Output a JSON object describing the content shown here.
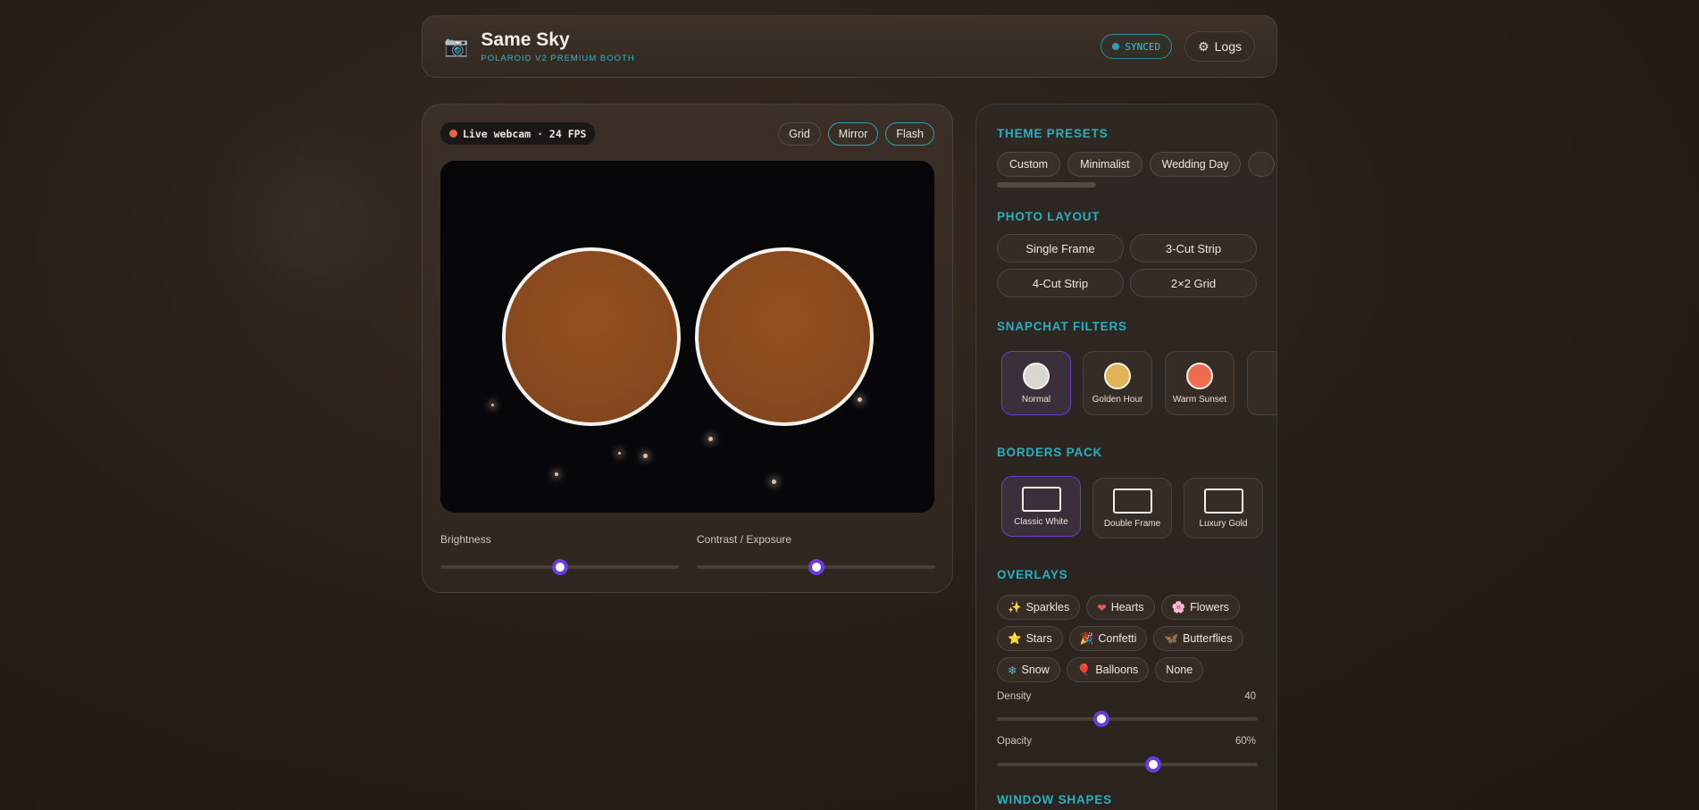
{
  "header": {
    "title": "Same Sky",
    "subtitle": "POLAROID V2 PREMIUM BOOTH",
    "synced_label": "SYNCED",
    "logs_label": "Logs",
    "camera_icon": "📷",
    "gear_icon": "⚙"
  },
  "stage": {
    "live_label": "Live webcam · 24 FPS",
    "toggles": [
      {
        "label": "Grid",
        "active": false
      },
      {
        "label": "Mirror",
        "active": true
      },
      {
        "label": "Flash",
        "active": true
      }
    ],
    "brightness_label": "Brightness",
    "brightness_value": 0.5,
    "contrast_label": "Contrast / Exposure",
    "contrast_value": 0.5
  },
  "sidebar": {
    "theme_presets": {
      "title": "THEME PRESETS",
      "items": [
        "Custom",
        "Minimalist",
        "Wedding Day"
      ]
    },
    "photo_layout": {
      "title": "PHOTO LAYOUT",
      "items": [
        "Single Frame",
        "3-Cut Strip",
        "4-Cut Strip",
        "2×2 Grid"
      ]
    },
    "filters": {
      "title": "SNAPCHAT FILTERS",
      "items": [
        {
          "label": "Normal",
          "color": "#d9d6d2",
          "selected": true
        },
        {
          "label": "Golden Hour",
          "color": "#e2b259",
          "selected": false
        },
        {
          "label": "Warm Sunset",
          "color": "#ee6d51",
          "selected": false
        }
      ]
    },
    "borders": {
      "title": "BORDERS PACK",
      "items": [
        {
          "label": "Classic White",
          "selected": true
        },
        {
          "label": "Double Frame",
          "selected": false
        },
        {
          "label": "Luxury Gold",
          "selected": false
        }
      ]
    },
    "overlays": {
      "title": "OVERLAYS",
      "items": [
        {
          "icon": "✨",
          "label": "Sparkles"
        },
        {
          "icon": "❤",
          "label": "Hearts"
        },
        {
          "icon": "🌸",
          "label": "Flowers"
        },
        {
          "icon": "⭐",
          "label": "Stars"
        },
        {
          "icon": "🎉",
          "label": "Confetti"
        },
        {
          "icon": "🦋",
          "label": "Butterflies"
        },
        {
          "icon": "❄",
          "label": "Snow"
        },
        {
          "icon": "🎈",
          "label": "Balloons"
        },
        {
          "icon": "",
          "label": "None"
        }
      ],
      "density_label": "Density",
      "density_value": "40",
      "opacity_label": "Opacity",
      "opacity_value": "60%"
    },
    "window_shapes": {
      "title": "WINDOW SHAPES"
    }
  },
  "colors": {
    "accent": "#27b0c2",
    "slider_thumb": "#6a3ce0",
    "rec": "#e8663f"
  }
}
